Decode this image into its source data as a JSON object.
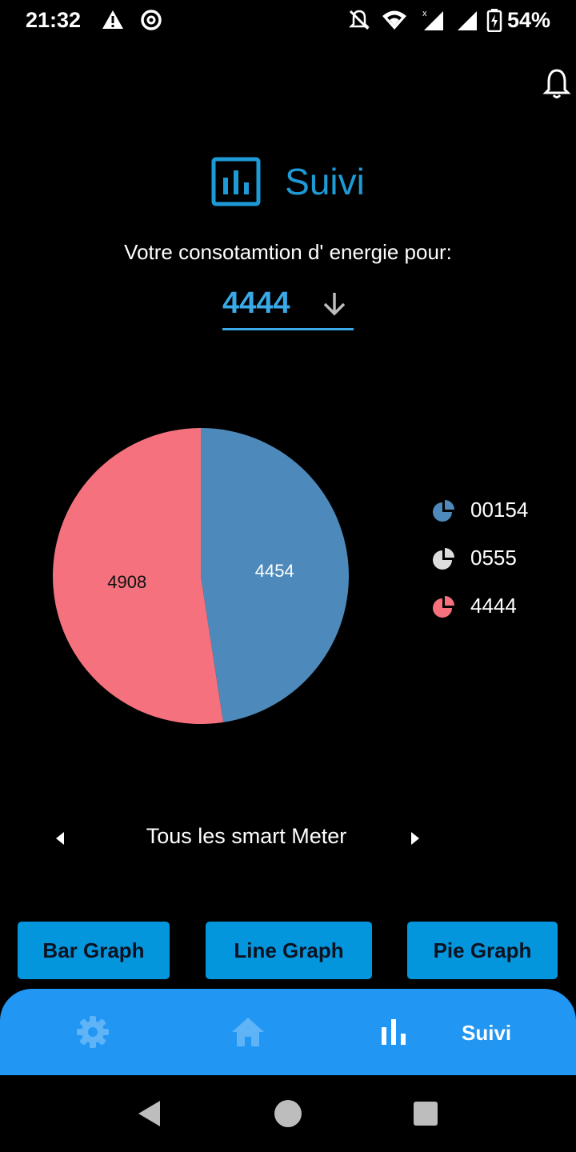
{
  "status_bar": {
    "time": "21:32",
    "battery": "54%"
  },
  "header": {
    "title": "Suivi"
  },
  "consumption": {
    "subtitle": "Votre consotamtion d' energie pour:",
    "selected_meter": "4444"
  },
  "chart_data": {
    "type": "pie",
    "slices": [
      {
        "label": "4454",
        "value": 4454,
        "color": "#4d8abb"
      },
      {
        "label": "4908",
        "value": 4908,
        "color": "#f4717d"
      }
    ],
    "legend": [
      {
        "label": "00154",
        "color": "#4d8abb"
      },
      {
        "label": "0555",
        "color": "#dddddd"
      },
      {
        "label": "4444",
        "color": "#f4717d"
      }
    ],
    "legend_position": "right"
  },
  "meter_nav": {
    "label": "Tous les smart Meter"
  },
  "graph_buttons": {
    "bar": "Bar Graph",
    "line": "Line  Graph",
    "pie": "Pie Graph"
  },
  "bottom_nav": {
    "active_label": "Suivi",
    "accent": "#2196f3"
  }
}
